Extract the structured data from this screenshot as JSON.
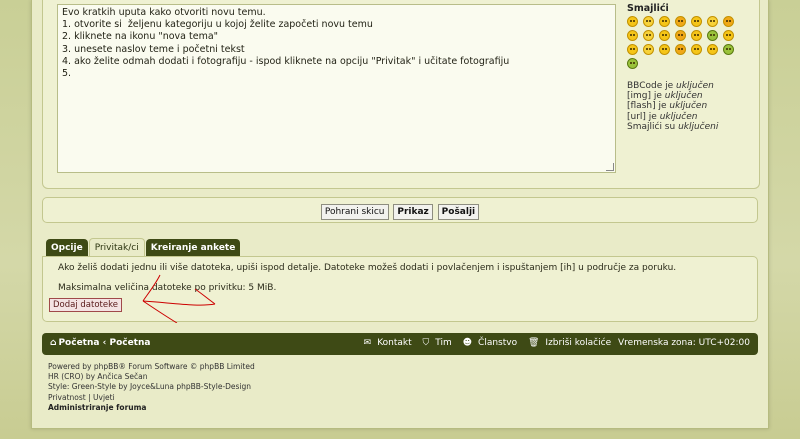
{
  "editor": {
    "lines": [
      "Evo kratkih uputa kako otvoriti novu temu.",
      "1. otvorite si  željenu kategoriju u kojoj želite započeti novu temu",
      "2. kliknete na ikonu \"nova tema\"",
      "3. unesete naslov teme i početni tekst",
      "4. ako želite odmah dodati i fotografiju - ispod kliknete na opciju \"Privitak\" i učitate fotografiju",
      "5."
    ]
  },
  "smilies": {
    "title": "Smajlići",
    "count": 22
  },
  "bbcode_status": {
    "bbcode_prefix": "BBCode je ",
    "bbcode_state": "uključen",
    "img_prefix": "[img] je ",
    "img_state": "uključen",
    "flash_prefix": "[flash] je ",
    "flash_state": "uključen",
    "url_prefix": "[url] je ",
    "url_state": "uključen",
    "smilies_prefix": "Smajlići su ",
    "smilies_state": "uključeni"
  },
  "submit": {
    "save_draft": "Pohrani skicu",
    "preview": "Prikaz",
    "submit": "Pošalji"
  },
  "tabs": [
    {
      "label": "Opcije"
    },
    {
      "label": "Privitak/ci"
    },
    {
      "label": "Kreiranje ankete"
    }
  ],
  "attachments": {
    "help": "Ako želiš dodati jednu ili više datoteka, upiši ispod detalje. Datoteke možeš dodati i povlačenjem i ispuštanjem [ih] u područje za poruku.",
    "max_size": "Maksimalna veličina datoteke po privitku: 5 MiB.",
    "add_files": "Dodaj datoteke"
  },
  "navbar": {
    "home": "Početna",
    "breadcrumb_sep": "‹",
    "home2": "Početna",
    "contact": "Kontakt",
    "team": "Tim",
    "members": "Članstvo",
    "delete_cookies": "Izbriši kolačiće",
    "timezone": "Vremenska zona: UTC+02:00"
  },
  "footer": {
    "powered": "Powered by phpBB® Forum Software © phpBB Limited",
    "translation": "HR (CRO) by Ančica Sečan",
    "style": "Style: Green-Style by Joyce&Luna phpBB-Style-Design",
    "privacy": "Privatnost | Uvjeti",
    "admin": "Administriranje foruma"
  },
  "colors": {
    "dark_green": "#3e4a15",
    "panel_bg": "#eff1d2",
    "page_bg": "#c9cf96",
    "arrow": "#cc0000"
  }
}
